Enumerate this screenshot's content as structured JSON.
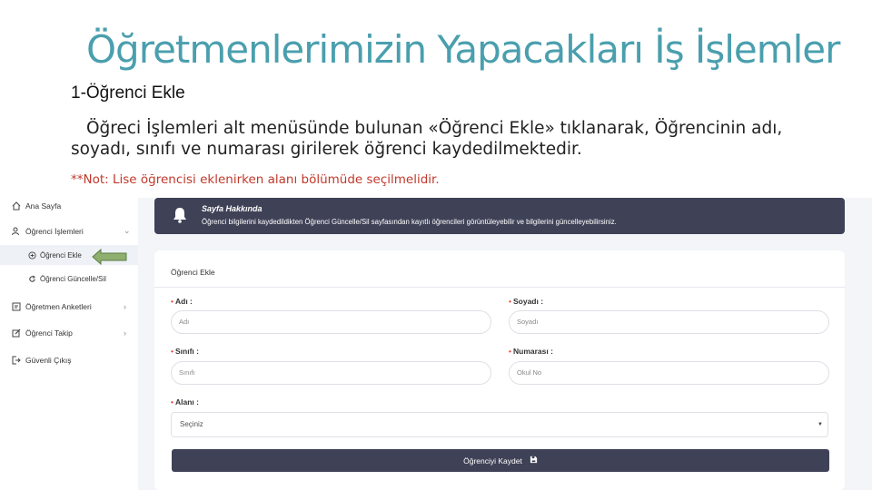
{
  "slide": {
    "title": "Öğretmenlerimizin Yapacakları İş İşlemler",
    "section_heading": "1-Öğrenci Ekle",
    "body": "Öğreci İşlemleri alt menüsünde bulunan «Öğrenci Ekle» tıklanarak, Öğrencinin adı, soyadı, sınıfı ve numarası girilerek öğrenci kaydedilmektedir.",
    "note": "**Not: Lise öğrencisi eklenirken alanı bölümüde seçilmelidir."
  },
  "sidebar": {
    "items": [
      {
        "label": "Ana Sayfa",
        "icon": "home-icon"
      },
      {
        "label": "Öğrenci İşlemleri",
        "icon": "users-icon"
      },
      {
        "label": "Öğretmen Anketleri",
        "icon": "survey-icon"
      },
      {
        "label": "Öğrenci Takip",
        "icon": "edit-icon"
      },
      {
        "label": "Güvenli Çıkış",
        "icon": "logout-icon"
      }
    ],
    "sub_items": [
      {
        "label": "Öğrenci Ekle",
        "icon": "add-circle-icon"
      },
      {
        "label": "Öğrenci Güncelle/Sil",
        "icon": "refresh-icon"
      }
    ]
  },
  "banner": {
    "title": "Sayfa Hakkında",
    "text": "Öğrenci bilgilerini kaydedildikten Öğrenci Güncelle/Sil sayfasından kayıtlı öğrencileri görüntüleyebilir ve bilgilerini güncelleyebilirsiniz."
  },
  "form": {
    "title": "Öğrenci Ekle",
    "fields": {
      "adi": {
        "label": "Adı :",
        "placeholder": "Adı"
      },
      "soyadi": {
        "label": "Soyadı :",
        "placeholder": "Soyadı"
      },
      "sinifi": {
        "label": "Sınıfı :",
        "placeholder": "Sınıfı"
      },
      "numarasi": {
        "label": "Numarası :",
        "placeholder": "Okul No"
      },
      "alani": {
        "label": "Alanı :",
        "value": "Seçiniz"
      }
    },
    "submit_label": "Öğrenciyi Kaydet"
  },
  "colors": {
    "title": "#4a9fae",
    "note": "#c0392b",
    "banner": "#3f4257",
    "arrow_fill": "#8faf6e"
  }
}
